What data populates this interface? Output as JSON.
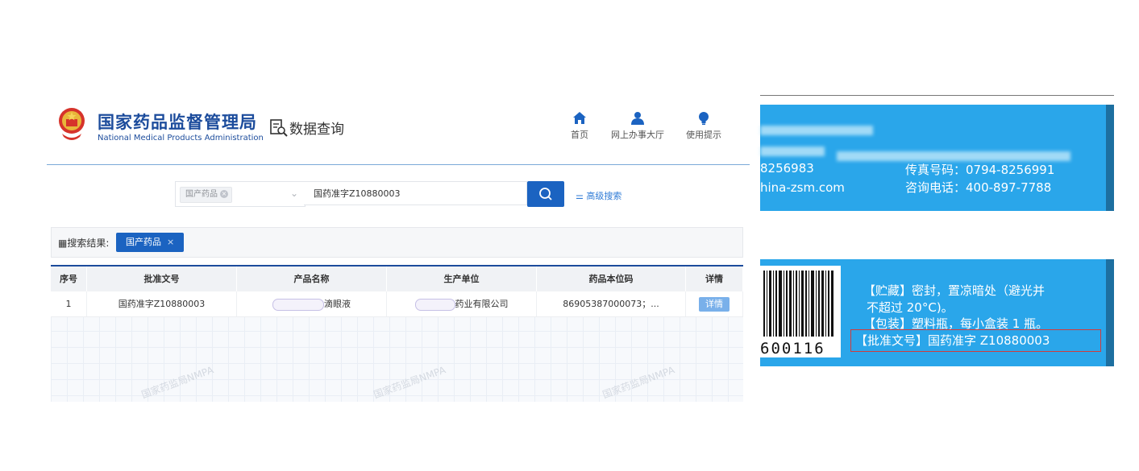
{
  "header": {
    "org_name_cn": "国家药品监督管理局",
    "org_name_en": "National Medical Products Administration",
    "section_title": "数据查询",
    "nav": [
      {
        "label": "首页",
        "icon": "home-icon"
      },
      {
        "label": "网上办事大厅",
        "icon": "user-icon"
      },
      {
        "label": "使用提示",
        "icon": "lightbulb-icon"
      }
    ]
  },
  "search": {
    "category_tag": "国产药品",
    "query": "国药准字Z10880003",
    "advanced_label": "高级搜索"
  },
  "results": {
    "label": "搜索结果:",
    "filter_tag": "国产药品"
  },
  "table": {
    "columns": [
      "序号",
      "批准文号",
      "产品名称",
      "生产单位",
      "药品本位码",
      "详情"
    ],
    "rows": [
      {
        "index": "1",
        "approval_no": "国药准字Z10880003",
        "product_suffix": "滴眼液",
        "manufacturer_suffix": "药业有限公司",
        "code": "86905387000073；...",
        "detail": "详情"
      }
    ]
  },
  "watermark": "国家药监局NMPA",
  "package": {
    "fax_left": "8256983",
    "fax": "传真号码：0794-8256991",
    "website": "hina-zsm.com",
    "hotline": "咨询电话：400-897-7788",
    "storage_line1": "【贮藏】密封，置凉暗处（避光并",
    "storage_line2": "不超过 20°C)。",
    "packaging": "【包装】塑料瓶，每小盒装 1 瓶。",
    "approval": "【批准文号】国药准字 Z10880003",
    "barcode_digits": "600116"
  },
  "colors": {
    "brand": "#1c4c9c",
    "primary_button": "#1b63c1",
    "package_blue": "#2aa6ea",
    "highlight_box": "#d23b3b"
  }
}
